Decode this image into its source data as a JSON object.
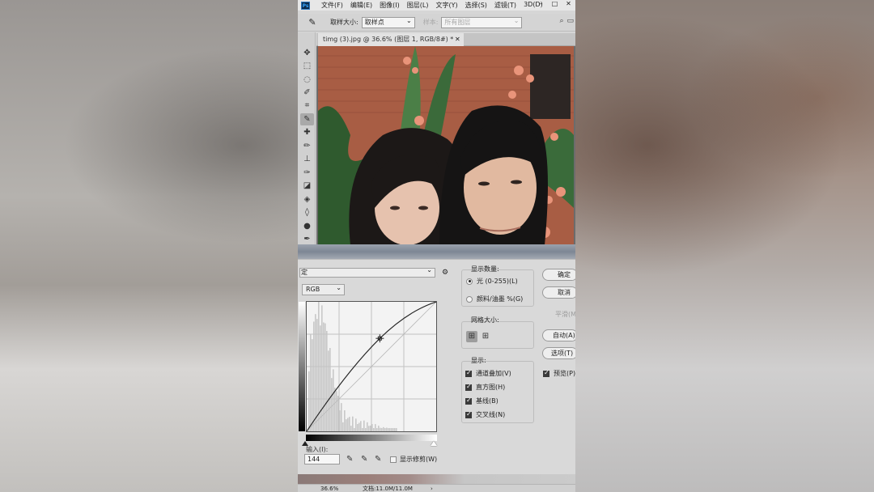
{
  "menubar": {
    "logo": "Ps",
    "items": [
      "文件(F)",
      "编辑(E)",
      "图像(I)",
      "图层(L)",
      "文字(Y)",
      "选择(S)",
      "滤镜(T)",
      "3D(D)"
    ],
    "window_buttons": [
      "–",
      "□",
      "✕"
    ]
  },
  "options_bar": {
    "sample_size_label": "取样大小:",
    "sample_size_value": "取样点",
    "sample_label": "样本:",
    "sample_value": "所有图层"
  },
  "document": {
    "tab_title": "timg (3).jpg @ 36.6% (图层 1, RGB/8#) *",
    "close": "✕"
  },
  "curves": {
    "preset_value": "定",
    "channel": "RGB",
    "input_label": "输入(I):",
    "input_value": "144",
    "show_clipping_label": "显示修剪(W)",
    "show_amount_title": "显示数量:",
    "light_option": "光 (0-255)(L)",
    "pigment_option": "颜料/油墨 %(G)",
    "grid_size_title": "网格大小:",
    "show_title": "显示:",
    "show_options": [
      {
        "label": "通道叠加(V)",
        "checked": true
      },
      {
        "label": "直方图(H)",
        "checked": true
      },
      {
        "label": "基线(B)",
        "checked": true
      },
      {
        "label": "交叉线(N)",
        "checked": true
      }
    ],
    "buttons": {
      "ok": "确定",
      "cancel": "取消",
      "smooth": "平滑(M)",
      "auto": "自动(A)",
      "options": "选项(T)",
      "preview": "预览(P)"
    },
    "preview_checked": true,
    "curve_point": {
      "input": 144,
      "output": 183
    },
    "accent_dark": "#3a3a3a"
  },
  "statusbar": {
    "zoom": "36.6%",
    "doc_info": "文档:11.0M/11.0M",
    "arrow": "›"
  }
}
